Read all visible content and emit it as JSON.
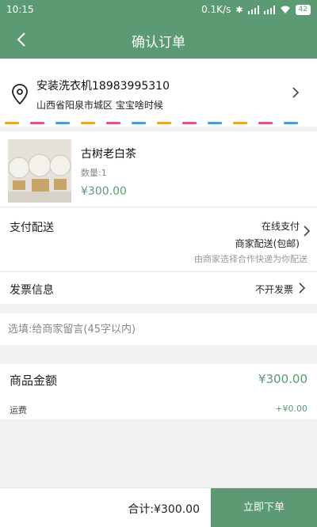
{
  "status_bar": {
    "time": "10:15",
    "speed": "0.1K/s",
    "battery": "42",
    "icons": [
      "bluetooth-icon",
      "signal-icon",
      "signal-icon",
      "wifi-icon",
      "battery-icon"
    ]
  },
  "header": {
    "title": "确认订单",
    "back_icon": "back-arrow-icon"
  },
  "address": {
    "name_phone": "安装洗衣机18983995310",
    "detail": "山西省阳泉市城区 宝宝啥时候",
    "icon": "location-pin-icon"
  },
  "stripe_colors": [
    "#e8a33c",
    "#d85a7f",
    "#4a9ed8"
  ],
  "product": {
    "name": "古树老白茶",
    "quantity": "数量:1",
    "price": "¥300.00"
  },
  "payment": {
    "label": "支付配送",
    "method": "在线支付",
    "delivery": "商家配送(包邮)",
    "note": "由商家选择合作快递为你配送"
  },
  "invoice": {
    "label": "发票信息",
    "value": "不开发票"
  },
  "message": {
    "placeholder": "选填:给商家留言(45字以内)",
    "value": ""
  },
  "totals": {
    "goods_label": "商品金额",
    "goods_amount": "¥300.00",
    "shipping_label": "运费",
    "shipping_amount": "+¥0.00"
  },
  "footer": {
    "total": "合计:¥300.00",
    "submit": "立即下单"
  },
  "colors": {
    "accent": "#5b9a72"
  }
}
